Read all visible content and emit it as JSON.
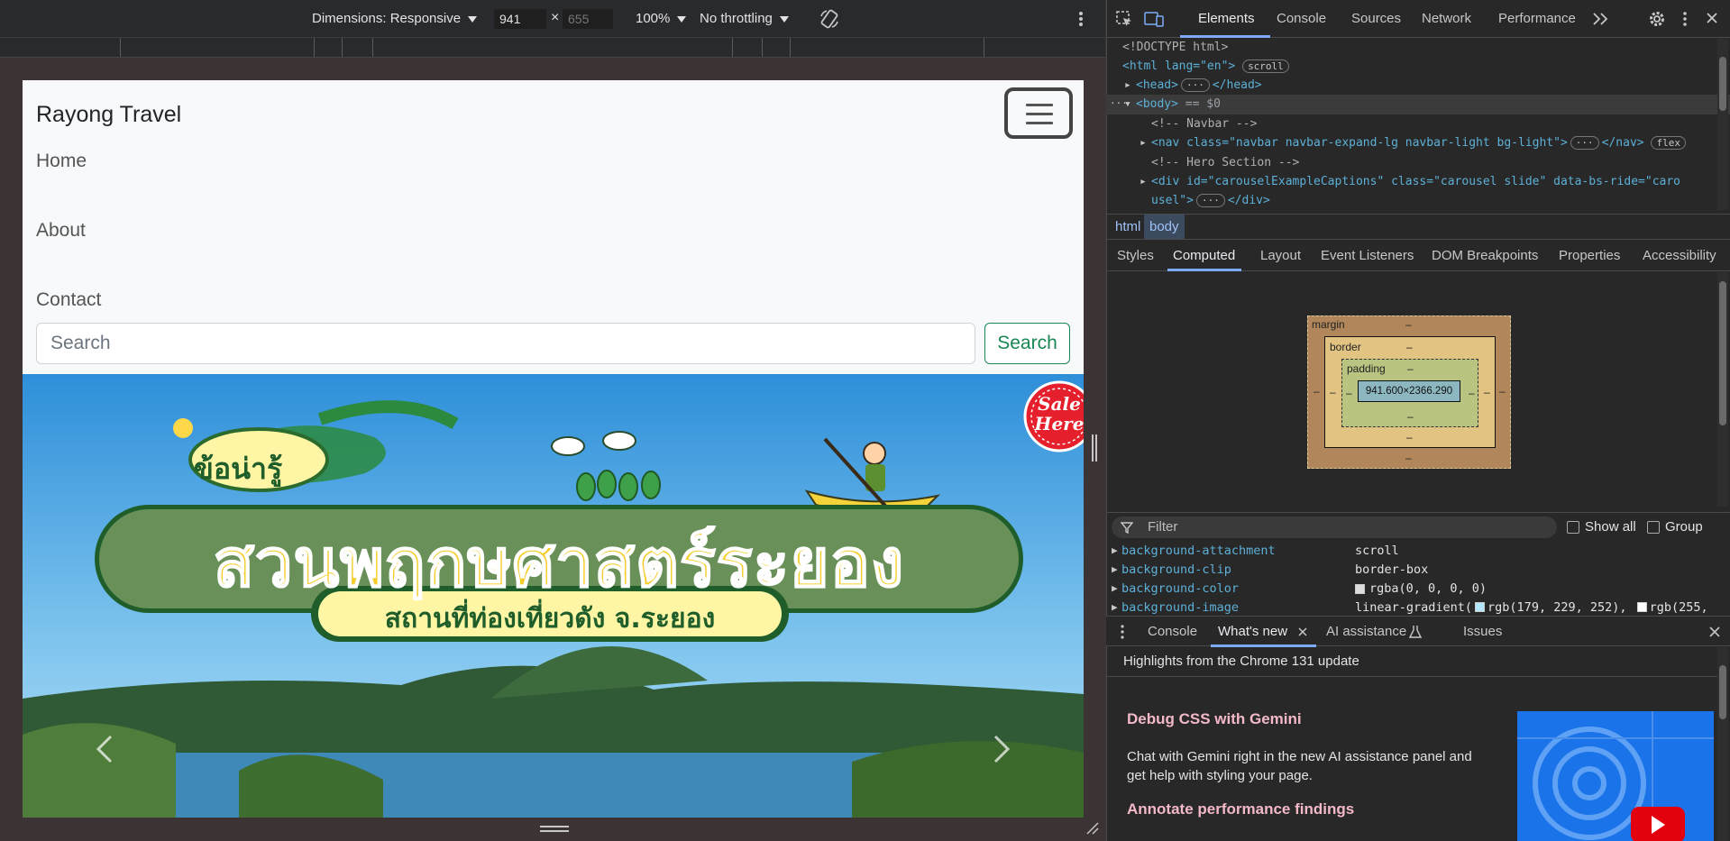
{
  "device_toolbar": {
    "dimensions_label": "Dimensions: Responsive",
    "width_value": "941",
    "times": "×",
    "height_value": "655",
    "zoom": "100%",
    "throttling": "No throttling"
  },
  "page": {
    "brand": "Rayong Travel",
    "nav_links": [
      "Home",
      "About",
      "Contact"
    ],
    "search_placeholder": "Search",
    "search_button": "Search",
    "hero": {
      "badge_top": "ข้อน่ารู้",
      "title": "สวนพฤกษศาสตร์ระยอง",
      "subtitle": "สถานที่ท่องเที่ยวดัง จ.ระยอง",
      "sale_line1": "Sale",
      "sale_line2": "Here"
    }
  },
  "devtools": {
    "main_tabs": [
      "Elements",
      "Console",
      "Sources",
      "Network",
      "Performance"
    ],
    "active_tab": "Elements",
    "dom_lines": {
      "doctype": "<!DOCTYPE html>",
      "html_open": "<html lang=\"en\">",
      "html_badge": "scroll",
      "head": "<head>",
      "head_close": "</head>",
      "body_open": "<body>",
      "body_eq": "== $0",
      "comment_navbar": "<!-- Navbar -->",
      "nav_line": "<nav class=\"navbar navbar-expand-lg navbar-light bg-light\">",
      "nav_close": "</nav>",
      "nav_badge": "flex",
      "comment_hero": "<!-- Hero Section -->",
      "div_line": "<div id=\"carouselExampleCaptions\" class=\"carousel slide\" data-bs-ride=\"caro",
      "div_line2": "usel\">",
      "div_close": "</div>"
    },
    "breadcrumbs": [
      "html",
      "body"
    ],
    "sub_tabs": [
      "Styles",
      "Computed",
      "Layout",
      "Event Listeners",
      "DOM Breakpoints",
      "Properties",
      "Accessibility"
    ],
    "active_sub_tab": "Computed",
    "box_model": {
      "margin_label": "margin",
      "border_label": "border",
      "padding_label": "padding",
      "dash": "–",
      "content_size": "941.600×2366.290"
    },
    "filter_placeholder": "Filter",
    "show_all": "Show all",
    "group": "Group",
    "computed_props": [
      {
        "name": "background-attachment",
        "value": "scroll"
      },
      {
        "name": "background-clip",
        "value": "border-box"
      },
      {
        "name": "background-color",
        "value": "rgba(0, 0, 0, 0)"
      },
      {
        "name": "background-image",
        "value": "linear-gradient(",
        "value2": "rgb(179, 229, 252),",
        "value3": "rgb(255,"
      }
    ],
    "drawer_tabs": [
      "Console",
      "What's new",
      "AI assistance",
      "Issues"
    ],
    "active_drawer_tab": "What's new",
    "whats_new": {
      "highlight": "Highlights from the Chrome 131 update",
      "h1": "Debug CSS with Gemini",
      "p1": "Chat with Gemini right in the new AI assistance panel and get help with styling your page.",
      "h2": "Annotate performance findings"
    }
  },
  "colors": {
    "accent_blue": "#7cacf8",
    "bootstrap_green": "#198754"
  }
}
